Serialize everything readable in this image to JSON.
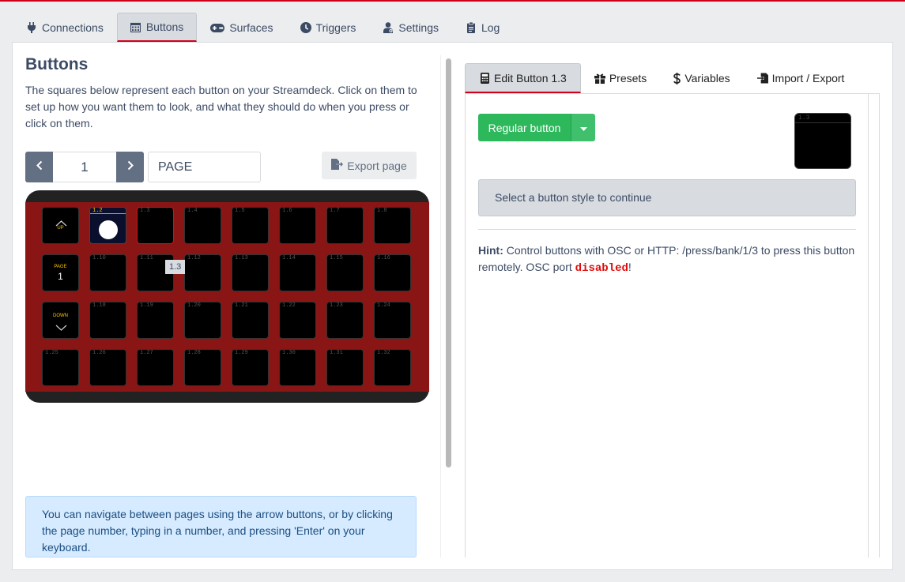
{
  "main_tabs": [
    {
      "label": "Connections",
      "icon": "plug-icon"
    },
    {
      "label": "Buttons",
      "icon": "calendar-grid-icon",
      "active": true
    },
    {
      "label": "Surfaces",
      "icon": "gamepad-icon"
    },
    {
      "label": "Triggers",
      "icon": "clock-icon"
    },
    {
      "label": "Settings",
      "icon": "user-cog-icon"
    },
    {
      "label": "Log",
      "icon": "clipboard-icon"
    }
  ],
  "left": {
    "title": "Buttons",
    "intro": "The squares below represent each button on your Streamdeck. Click on them to set up how you want them to look, and what they should do when you press or click on them.",
    "page_number": "1",
    "page_name": "PAGE",
    "export_label": "Export page",
    "nav_up": "UP",
    "nav_page": "PAGE",
    "nav_page_num": "1",
    "nav_down": "DOWN",
    "tooltip": "1.3",
    "info": "You can navigate between pages using the arrow buttons, or by clicking the page number, typing in a number, and pressing 'Enter' on your keyboard."
  },
  "grid_labels": {
    "k2": "1.2",
    "k3": "1.3",
    "k4": "1.4",
    "k5": "1.5",
    "k6": "1.6",
    "k7": "1.7",
    "k8": "1.8",
    "k10": "1.10",
    "k11": "1.11",
    "k12": "1.12",
    "k13": "1.13",
    "k14": "1.14",
    "k15": "1.15",
    "k16": "1.16",
    "k18": "1.18",
    "k19": "1.19",
    "k20": "1.20",
    "k21": "1.21",
    "k22": "1.22",
    "k23": "1.23",
    "k24": "1.24",
    "k25": "1.25",
    "k26": "1.26",
    "k27": "1.27",
    "k28": "1.28",
    "k29": "1.29",
    "k30": "1.30",
    "k31": "1.31",
    "k32": "1.32"
  },
  "right": {
    "tabs": [
      {
        "label": "Edit Button 1.3",
        "icon": "calculator-icon",
        "active": true
      },
      {
        "label": "Presets",
        "icon": "gift-icon"
      },
      {
        "label": "Variables",
        "icon": "dollar-icon"
      },
      {
        "label": "Import / Export",
        "icon": "file-import-icon"
      }
    ],
    "style_button": "Regular button",
    "preview_label": "1.3",
    "select_msg": "Select a button style to continue",
    "hint_bold": "Hint:",
    "hint_text": " Control buttons with OSC or HTTP: /press/bank/1/3 to press this button remotely. OSC port ",
    "hint_code": "disabled",
    "hint_end": "!"
  },
  "colors": {
    "accent": "#d0021b",
    "deck_red": "#8a1515",
    "success": "#2eb85c",
    "info_bg": "#d6ebff"
  }
}
